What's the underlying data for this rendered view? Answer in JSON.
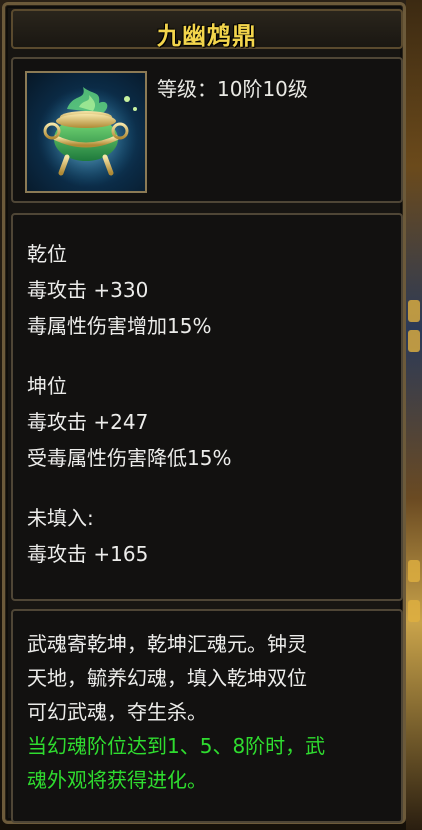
{
  "item": {
    "title": "九幽鸩鼎",
    "level_text": "等级：10阶10级",
    "icon": "green-cauldron-icon"
  },
  "stats": {
    "qian": {
      "heading": "乾位",
      "attack": "毒攻击 +330",
      "bonus": "毒属性伤害增加15%"
    },
    "kun": {
      "heading": "坤位",
      "attack": "毒攻击 +247",
      "bonus": "受毒属性伤害降低15%"
    },
    "empty": {
      "heading": "未填入:",
      "attack": "毒攻击 +165"
    }
  },
  "description": {
    "lines_white": [
      "武魂寄乾坤，乾坤汇魂元。钟灵",
      "天地，毓养幻魂，填入乾坤双位",
      "可幻武魂，夺生杀。"
    ],
    "lines_green": [
      "当幻魂阶位达到1、5、8阶时，武",
      "魂外观将获得进化。"
    ]
  },
  "colors": {
    "title": "#f3d54c",
    "text": "#ececea",
    "highlight": "#2fdc2f",
    "border": "#6c5a3a"
  }
}
